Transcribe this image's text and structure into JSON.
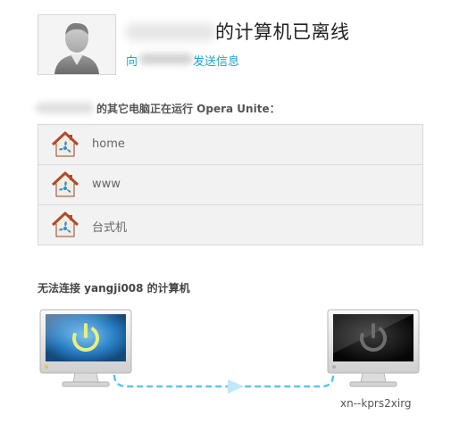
{
  "header": {
    "title_suffix": "的计算机已离线",
    "send_prefix": "向",
    "send_link": "发送信息"
  },
  "other_computers": {
    "heading": "的其它电脑正在运行 Opera Unite："
  },
  "devices": [
    {
      "label": "home",
      "icon": "unite-house-icon"
    },
    {
      "label": "www",
      "icon": "unite-house-icon"
    },
    {
      "label": "台式机",
      "icon": "unite-house-icon"
    }
  ],
  "connection": {
    "heading": "无法连接 yangji008 的计算机",
    "remote_hostname": "xn--kprs2xirg",
    "local_state": "on",
    "remote_state": "off"
  },
  "colors": {
    "link": "#1fa3c8",
    "dash_line": "#5ec5ea",
    "power_on": "#e7f07a"
  }
}
